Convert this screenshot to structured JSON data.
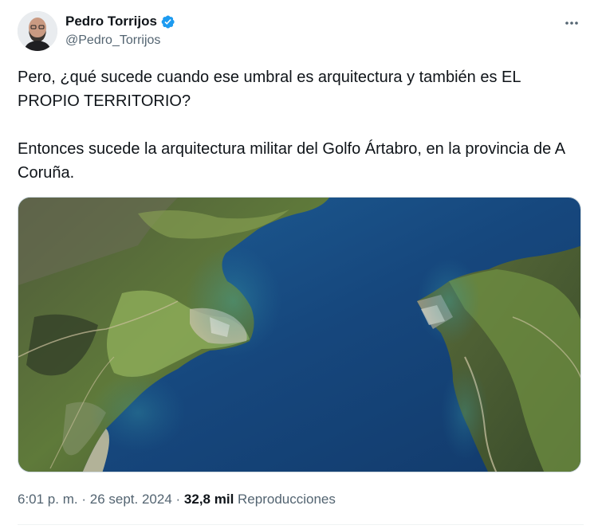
{
  "author": {
    "display_name": "Pedro Torrijos",
    "handle": "@Pedro_Torrijos",
    "verified": true
  },
  "tweet": {
    "paragraphs": [
      "Pero, ¿qué sucede cuando ese umbral es arquitectura y también es EL PROPIO TERRITORIO?",
      "Entonces sucede la arquitectura militar del Golfo Ártabro, en la provincia de A Coruña."
    ]
  },
  "meta": {
    "time": "6:01 p. m.",
    "separator": "·",
    "date": "26 sept. 2024",
    "views_count": "32,8 mil",
    "views_label": "Reproducciones"
  },
  "icons": {
    "verified": "verified-badge-icon",
    "more": "more-options-icon"
  },
  "colors": {
    "verified": "#1d9bf0",
    "secondary_text": "#536471",
    "primary_text": "#0f1419",
    "water": "#1b4f86"
  }
}
